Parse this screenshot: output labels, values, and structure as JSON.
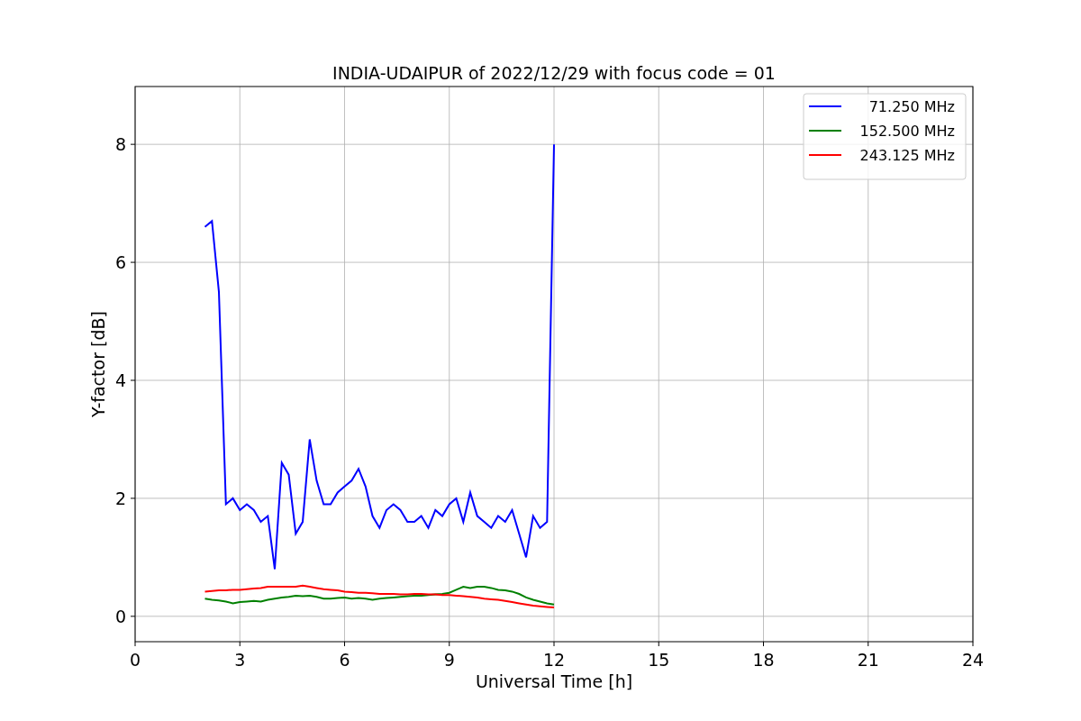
{
  "chart_data": {
    "type": "line",
    "title": "INDIA-UDAIPUR of 2022/12/29 with focus code = 01",
    "xlabel": "Universal Time [h]",
    "ylabel": "Y-factor [dB]",
    "x": [
      2,
      2.2,
      2.4,
      2.6,
      2.8,
      3,
      3.2,
      3.4,
      3.6,
      3.8,
      4,
      4.2,
      4.4,
      4.6,
      4.8,
      5,
      5.2,
      5.4,
      5.6,
      5.8,
      6,
      6.2,
      6.4,
      6.6,
      6.8,
      7,
      7.2,
      7.4,
      7.6,
      7.8,
      8,
      8.2,
      8.4,
      8.6,
      8.8,
      9,
      9.2,
      9.4,
      9.6,
      9.8,
      10,
      10.2,
      10.4,
      10.6,
      10.8,
      11,
      11.2,
      11.4,
      11.6,
      11.8,
      12
    ],
    "series": [
      {
        "name": "71.250 MHz",
        "color": "#0000ff",
        "values": [
          6.6,
          6.7,
          5.5,
          1.9,
          2.0,
          1.8,
          1.9,
          1.8,
          1.6,
          1.7,
          0.8,
          2.6,
          2.4,
          1.4,
          1.6,
          3.0,
          2.3,
          1.9,
          1.9,
          2.1,
          2.2,
          2.3,
          2.5,
          2.2,
          1.7,
          1.5,
          1.8,
          1.9,
          1.8,
          1.6,
          1.6,
          1.7,
          1.5,
          1.8,
          1.7,
          1.9,
          2.0,
          1.6,
          2.1,
          1.7,
          1.6,
          1.5,
          1.7,
          1.6,
          1.8,
          1.4,
          1.0,
          1.7,
          1.5,
          1.6,
          8.0
        ]
      },
      {
        "name": "152.500 MHz",
        "color": "#008000",
        "values": [
          0.3,
          0.28,
          0.27,
          0.25,
          0.22,
          0.24,
          0.25,
          0.26,
          0.25,
          0.28,
          0.3,
          0.32,
          0.33,
          0.35,
          0.34,
          0.35,
          0.33,
          0.3,
          0.3,
          0.31,
          0.32,
          0.3,
          0.31,
          0.3,
          0.28,
          0.3,
          0.31,
          0.32,
          0.33,
          0.34,
          0.35,
          0.35,
          0.36,
          0.37,
          0.38,
          0.4,
          0.45,
          0.5,
          0.48,
          0.5,
          0.5,
          0.48,
          0.45,
          0.44,
          0.42,
          0.38,
          0.32,
          0.28,
          0.25,
          0.22,
          0.2
        ]
      },
      {
        "name": "243.125 MHz",
        "color": "#ff0000",
        "values": [
          0.42,
          0.43,
          0.44,
          0.44,
          0.45,
          0.45,
          0.46,
          0.47,
          0.48,
          0.5,
          0.5,
          0.5,
          0.5,
          0.5,
          0.52,
          0.5,
          0.48,
          0.46,
          0.45,
          0.44,
          0.42,
          0.41,
          0.4,
          0.4,
          0.39,
          0.38,
          0.38,
          0.38,
          0.37,
          0.37,
          0.38,
          0.38,
          0.37,
          0.37,
          0.36,
          0.36,
          0.35,
          0.34,
          0.33,
          0.32,
          0.3,
          0.29,
          0.28,
          0.26,
          0.24,
          0.22,
          0.2,
          0.18,
          0.17,
          0.16,
          0.15
        ]
      }
    ],
    "xlim": [
      0,
      24
    ],
    "ylim": [
      -0.43,
      8.98
    ],
    "xticks": [
      0,
      3,
      6,
      9,
      12,
      15,
      18,
      21,
      24
    ],
    "yticks": [
      0,
      2,
      4,
      6,
      8
    ],
    "grid": true,
    "legend": "upper right"
  }
}
